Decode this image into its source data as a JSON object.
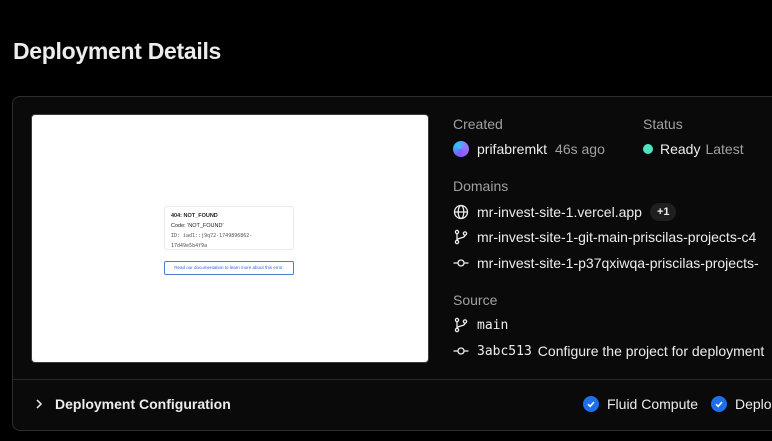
{
  "page": {
    "title": "Deployment Details"
  },
  "preview": {
    "error_code": "404: NOT_FOUND",
    "code_line": "Code: 'NOT_FOUND'",
    "id_line": "ID: iad1::j9q72-1749896862-17d49e5b4f9a",
    "link_text": "Read our documentation to learn more about this error."
  },
  "details": {
    "created_label": "Created",
    "created_user": "prifabremkt",
    "created_time": "46s ago",
    "status_label": "Status",
    "status_value": "Ready",
    "status_tag": "Latest",
    "status_color": "#50e3c2",
    "domains_label": "Domains",
    "domains": [
      {
        "url": "mr-invest-site-1.vercel.app",
        "icon": "globe-icon",
        "extra": "+1"
      },
      {
        "url": "mr-invest-site-1-git-main-priscilas-projects-c4",
        "icon": "git-branch-icon"
      },
      {
        "url": "mr-invest-site-1-p37qxiwqa-priscilas-projects-",
        "icon": "git-commit-icon"
      }
    ],
    "source_label": "Source",
    "source_branch": "main",
    "source_commit_hash": "3abc513",
    "source_commit_message": "Configure the project for deployment"
  },
  "footer": {
    "config_label": "Deployment Configuration",
    "features": [
      "Fluid Compute",
      "Deplo"
    ],
    "accent": "#1f6feb"
  }
}
